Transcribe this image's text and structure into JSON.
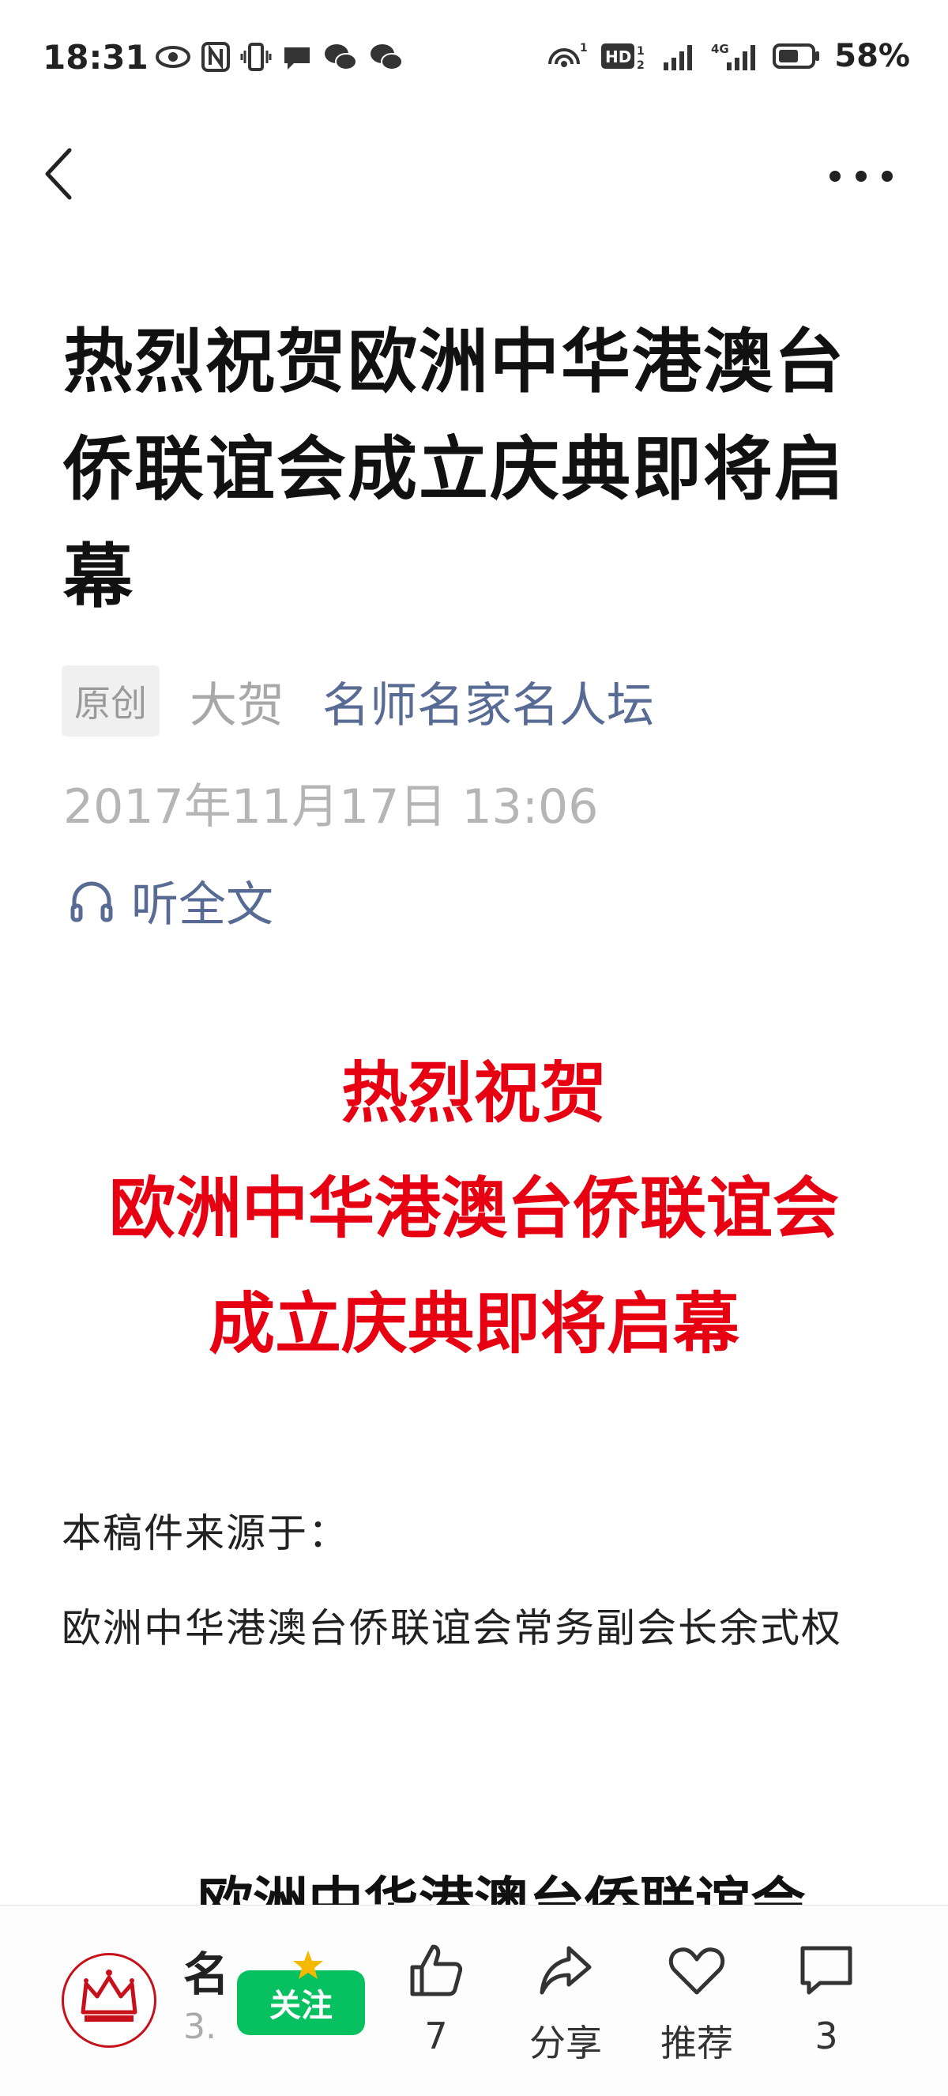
{
  "status_bar": {
    "time": "18:31",
    "battery_percent": "58%",
    "hd_label": "HD",
    "network_label": "4G",
    "hotspot_count": "1",
    "hd_sim": "1",
    "hd_sim2": "2"
  },
  "article": {
    "title": "热烈祝贺欧洲中华港澳台侨联谊会成立庆典即将启幕",
    "original_badge": "原创",
    "author": "大贺",
    "account_name": "名师名家名人坛",
    "publish_date": "2017年11月17日 13:06",
    "listen_label": "听全文",
    "red_heading": {
      "line1": "热烈祝贺",
      "line2": "欧洲中华港澳台侨联谊会",
      "line3": "成立庆典即将启幕"
    },
    "body_source_label": "本稿件来源于：",
    "body_source_text": "欧洲中华港澳台侨联谊会常务副会长余式权",
    "partial_heading": "欧洲中华港澳台侨联谊会"
  },
  "bottom_bar": {
    "account_name_partial": "名",
    "account_sub_partial": "3.",
    "follow_label": "关注",
    "like_count": "7",
    "share_label": "分享",
    "recommend_label": "推荐",
    "comment_count": "3"
  },
  "colors": {
    "red_heading": "#e60012",
    "link_blue": "#576b95",
    "follow_green": "#07c160"
  }
}
